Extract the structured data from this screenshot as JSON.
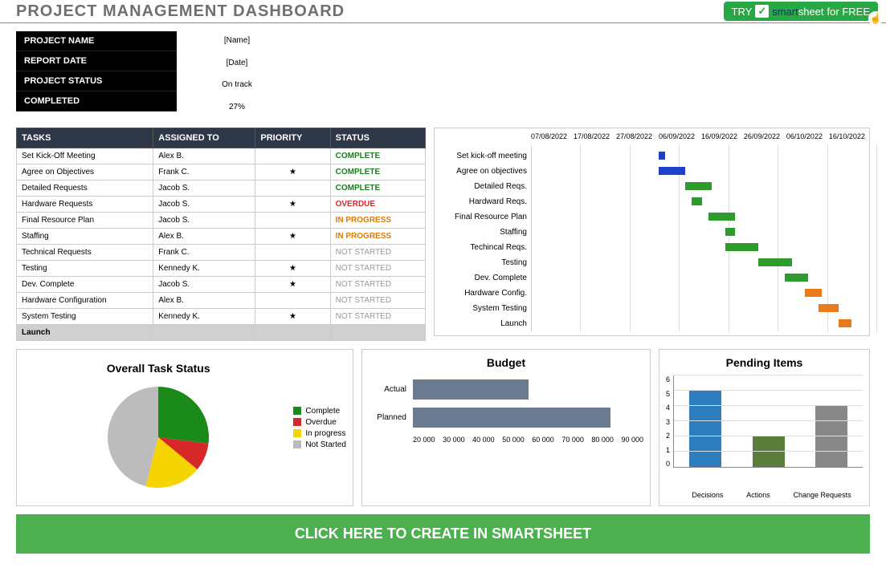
{
  "header": {
    "title": "PROJECT MANAGEMENT DASHBOARD",
    "try_label_pre": "TRY",
    "try_brand_1": "smart",
    "try_brand_2": "sheet",
    "try_label_post": "for FREE"
  },
  "info": {
    "labels": [
      "PROJECT NAME",
      "REPORT DATE",
      "PROJECT STATUS",
      "COMPLETED"
    ],
    "values": [
      "[Name]",
      "[Date]",
      "On track",
      "27%"
    ]
  },
  "tasks": {
    "headers": [
      "TASKS",
      "ASSIGNED TO",
      "PRIORITY",
      "STATUS"
    ],
    "rows": [
      {
        "task": "Set Kick-Off Meeting",
        "assigned": "Alex B.",
        "priority": "",
        "status": "COMPLETE",
        "cls": "st-complete"
      },
      {
        "task": "Agree on Objectives",
        "assigned": "Frank C.",
        "priority": "★",
        "status": "COMPLETE",
        "cls": "st-complete"
      },
      {
        "task": "Detailed Requests",
        "assigned": "Jacob S.",
        "priority": "",
        "status": "COMPLETE",
        "cls": "st-complete"
      },
      {
        "task": "Hardware Requests",
        "assigned": "Jacob S.",
        "priority": "★",
        "status": "OVERDUE",
        "cls": "st-overdue"
      },
      {
        "task": "Final Resource Plan",
        "assigned": "Jacob S.",
        "priority": "",
        "status": "IN PROGRESS",
        "cls": "st-inprogress"
      },
      {
        "task": "Staffing",
        "assigned": "Alex B.",
        "priority": "★",
        "status": "IN PROGRESS",
        "cls": "st-inprogress"
      },
      {
        "task": "Technical Requests",
        "assigned": "Frank C.",
        "priority": "",
        "status": "NOT STARTED",
        "cls": "st-notstarted"
      },
      {
        "task": "Testing",
        "assigned": "Kennedy K.",
        "priority": "★",
        "status": "NOT STARTED",
        "cls": "st-notstarted"
      },
      {
        "task": "Dev. Complete",
        "assigned": "Jacob S.",
        "priority": "★",
        "status": "NOT STARTED",
        "cls": "st-notstarted"
      },
      {
        "task": "Hardware Configuration",
        "assigned": "Alex B.",
        "priority": "",
        "status": "NOT STARTED",
        "cls": "st-notstarted"
      },
      {
        "task": "System Testing",
        "assigned": "Kennedy K.",
        "priority": "★",
        "status": "NOT STARTED",
        "cls": "st-notstarted"
      }
    ],
    "launch_label": "Launch"
  },
  "gantt": {
    "dates": [
      "07/08/2022",
      "17/08/2022",
      "27/08/2022",
      "06/09/2022",
      "16/09/2022",
      "26/09/2022",
      "06/10/2022",
      "16/10/2022"
    ],
    "rows": [
      {
        "label": "Set kick-off meeting",
        "start": 38,
        "width": 2,
        "color": "#1e3fca"
      },
      {
        "label": "Agree on objectives",
        "start": 38,
        "width": 8,
        "color": "#1e3fca"
      },
      {
        "label": "Detailed Reqs.",
        "start": 46,
        "width": 8,
        "color": "#2d9c2d"
      },
      {
        "label": "Hardward Reqs.",
        "start": 48,
        "width": 3,
        "color": "#2d9c2d"
      },
      {
        "label": "Final Resource Plan",
        "start": 53,
        "width": 8,
        "color": "#2d9c2d"
      },
      {
        "label": "Staffing",
        "start": 58,
        "width": 3,
        "color": "#2d9c2d"
      },
      {
        "label": "Techincal Reqs.",
        "start": 58,
        "width": 10,
        "color": "#2d9c2d"
      },
      {
        "label": "Testing",
        "start": 68,
        "width": 10,
        "color": "#2d9c2d"
      },
      {
        "label": "Dev. Complete",
        "start": 76,
        "width": 7,
        "color": "#2d9c2d"
      },
      {
        "label": "Hardware Config.",
        "start": 82,
        "width": 5,
        "color": "#e87b1c"
      },
      {
        "label": "System Testing",
        "start": 86,
        "width": 6,
        "color": "#e87b1c"
      },
      {
        "label": "Launch",
        "start": 92,
        "width": 4,
        "color": "#e87b1c"
      }
    ]
  },
  "chart_data": [
    {
      "type": "pie",
      "title": "Overall Task Status",
      "series": [
        {
          "name": "Complete",
          "value": 27,
          "color": "#1a8a1a"
        },
        {
          "name": "Overdue",
          "value": 9,
          "color": "#d62828"
        },
        {
          "name": "In progress",
          "value": 18,
          "color": "#f5d400"
        },
        {
          "name": "Not Started",
          "value": 46,
          "color": "#bcbcbc"
        }
      ]
    },
    {
      "type": "bar",
      "title": "Budget",
      "orientation": "horizontal",
      "categories": [
        "Actual",
        "Planned"
      ],
      "values": [
        55000,
        80000
      ],
      "xlim": [
        20000,
        90000
      ],
      "xticks": [
        "20 000",
        "30 000",
        "40 000",
        "50 000",
        "60 000",
        "70 000",
        "80 000",
        "90 000"
      ]
    },
    {
      "type": "bar",
      "title": "Pending Items",
      "categories": [
        "Decisions",
        "Actions",
        "Change Requests"
      ],
      "values": [
        5,
        2,
        4
      ],
      "colors": [
        "#2e7dbf",
        "#5a7d3c",
        "#888888"
      ],
      "ylim": [
        0,
        6
      ],
      "yticks": [
        "6",
        "5",
        "4",
        "3",
        "2",
        "1",
        "0"
      ]
    }
  ],
  "cta": "CLICK HERE TO CREATE IN SMARTSHEET"
}
